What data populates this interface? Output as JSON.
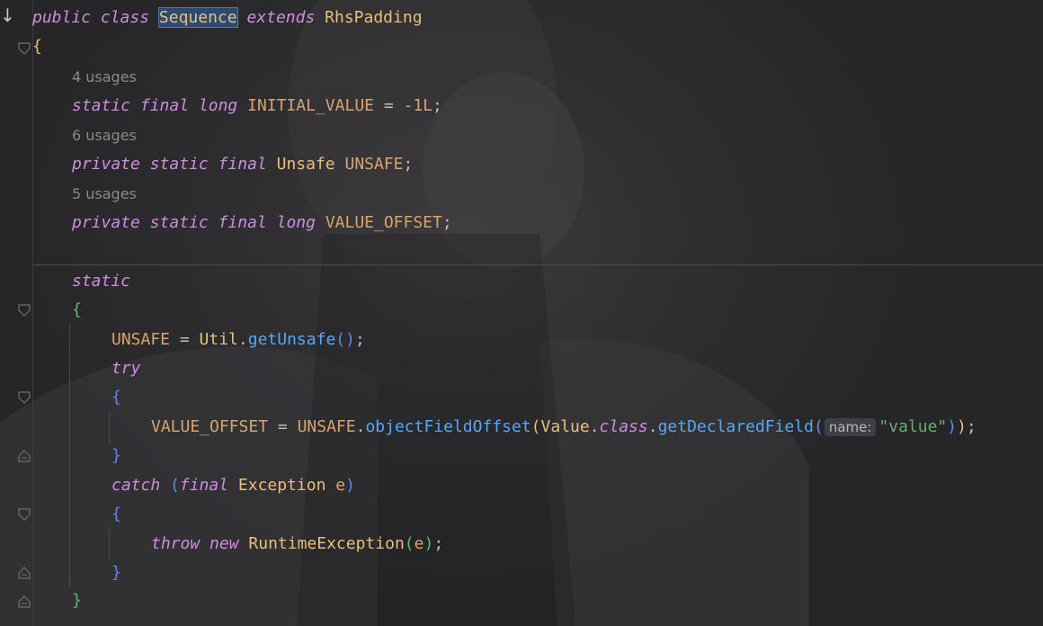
{
  "editor": {
    "gutter_icons": [
      "arrow-down-icon",
      "fold-icon"
    ],
    "lines": {
      "class_decl": {
        "kw_public": "public",
        "kw_class": "class",
        "class_name": "Sequence",
        "kw_extends": "extends",
        "super_name": "RhsPadding"
      },
      "open_brace": "{",
      "usage_1": "4 usages",
      "field_1": {
        "kw1": "static",
        "kw2": "final",
        "kw3": "long",
        "name": "INITIAL_VALUE",
        "eq": " = ",
        "value": "-1L",
        "semi": ";"
      },
      "usage_2": "6 usages",
      "field_2": {
        "kw1": "private",
        "kw2": "static",
        "kw3": "final",
        "type": "Unsafe",
        "name": "UNSAFE",
        "semi": ";"
      },
      "usage_3": "5 usages",
      "field_3": {
        "kw1": "private",
        "kw2": "static",
        "kw3": "final",
        "kw4": "long",
        "name": "VALUE_OFFSET",
        "semi": ";"
      },
      "static_kw": "static",
      "static_open": "{",
      "assign": {
        "lhs": "UNSAFE",
        "eq": " = ",
        "cls": "Util",
        "dot": ".",
        "method": "getUnsafe",
        "parens": "()",
        "semi": ";"
      },
      "try_kw": "try",
      "try_open": "{",
      "offset": {
        "lhs": "VALUE_OFFSET",
        "eq": " = ",
        "obj": "UNSAFE",
        "dot1": ".",
        "method1": "objectFieldOffset",
        "po": "(",
        "cls": "Value",
        "dot2": ".",
        "kw_class": "class",
        "dot3": ".",
        "method2": "getDeclaredField",
        "po2": "(",
        "hint": "name:",
        "arg": "\"value\"",
        "pc2": ")",
        "pc": ")",
        "semi": ";"
      },
      "try_close": "}",
      "catch": {
        "kw": "catch",
        "po": "(",
        "kw_final": "final",
        "type": "Exception",
        "var": "e",
        "pc": ")"
      },
      "catch_open": "{",
      "throw": {
        "kw_throw": "throw",
        "kw_new": "new",
        "type": "RuntimeException",
        "po": "(",
        "var": "e",
        "pc": ")",
        "semi": ";"
      },
      "catch_close": "}",
      "static_close": "}"
    }
  }
}
